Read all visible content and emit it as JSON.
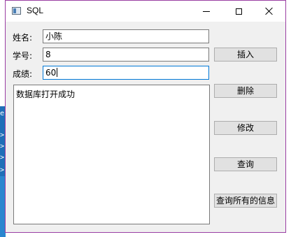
{
  "window": {
    "title": "SQL"
  },
  "form": {
    "name_label": "姓名:",
    "name_value": "小陈",
    "id_label": "学号:",
    "id_value": "8",
    "score_label": "成绩:",
    "score_value": "60"
  },
  "output": {
    "text": "数据库打开成功"
  },
  "buttons": {
    "insert": "插入",
    "delete": "删除",
    "update": "修改",
    "query": "查询",
    "query_all": "查询所有的信息"
  },
  "background": {
    "glyphs": [
      "m",
      "e",
      ">",
      ">",
      ">",
      ">"
    ]
  },
  "colors": {
    "window_border": "#9a3ea3",
    "focus_border": "#0078d7",
    "background_blue": "#2a86cf"
  }
}
